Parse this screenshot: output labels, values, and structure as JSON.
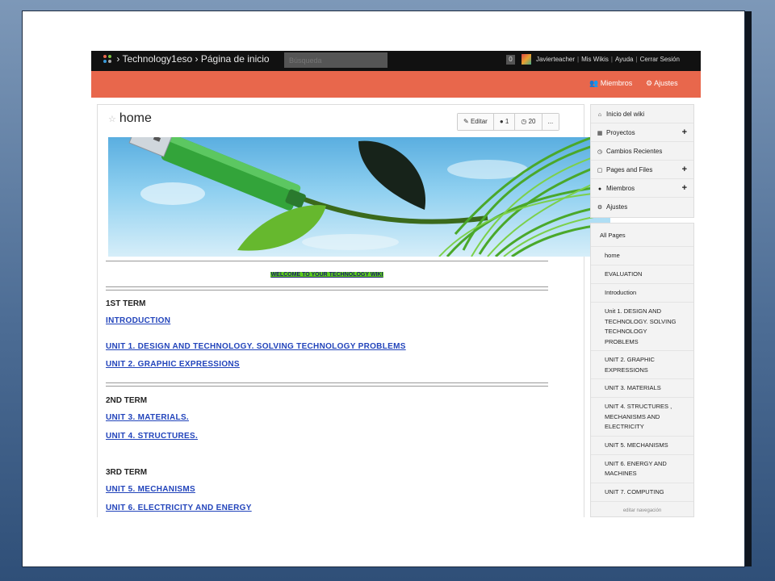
{
  "topbar": {
    "breadcrumb": "› Technology1eso › Página de inicio",
    "search_placeholder": "Búsqueda",
    "notification_count": "0",
    "user": "Javierteacher",
    "links": [
      "Mis Wikis",
      "Ayuda",
      "Cerrar Sesión"
    ]
  },
  "orangebar": {
    "members": "Miembros",
    "settings": "Ajustes"
  },
  "page": {
    "title": "home",
    "edit_label": "Editar",
    "comments_count": "1",
    "history_count": "20",
    "more_label": "..."
  },
  "content": {
    "welcome": "WELCOME TO YOUR TECHNOLOGY WIKI",
    "terms": [
      {
        "heading": "1ST TERM",
        "links": [
          "INTRODUCTION",
          "UNIT 1. DESIGN AND TECHNOLOGY. SOLVING TECHNOLOGY PROBLEMS",
          "UNIT 2. GRAPHIC EXPRESSIONS"
        ]
      },
      {
        "heading": "2ND TERM",
        "links": [
          "UNIT 3. MATERIALS.",
          "UNIT 4. STRUCTURES."
        ]
      },
      {
        "heading": "3RD TERM",
        "links": [
          "UNIT 5. MECHANISMS",
          "UNIT 6. ELECTRICITY AND ENERGY"
        ]
      }
    ]
  },
  "sidebar": {
    "nav": [
      {
        "icon": "home-icon",
        "label": "Inicio del wiki",
        "plus": ""
      },
      {
        "icon": "sitemap-icon",
        "label": "Proyectos",
        "plus": "+"
      },
      {
        "icon": "clock-icon",
        "label": "Cambios Recientes",
        "plus": ""
      },
      {
        "icon": "file-icon",
        "label": "Pages and Files",
        "plus": "+"
      },
      {
        "icon": "user-icon",
        "label": "Miembros",
        "plus": "+"
      },
      {
        "icon": "gear-icon",
        "label": "Ajustes",
        "plus": ""
      }
    ],
    "pages_header": "All Pages",
    "pages": [
      [
        "home"
      ],
      [
        "EVALUATION"
      ],
      [
        "Introduction"
      ],
      [
        "Unit 1. DESIGN AND",
        "TECHNOLOGY. SOLVING",
        "TECHNOLOGY",
        "PROBLEMS"
      ],
      [
        "UNIT 2. GRAPHIC",
        "EXPRESSIONS"
      ],
      [
        "UNIT 3. MATERIALS"
      ],
      [
        "UNIT 4. STRUCTURES ,",
        "MECHANISMS AND",
        "ELECTRICITY"
      ],
      [
        "UNIT 5. MECHANISMS"
      ],
      [
        "UNIT 6. ENERGY AND",
        "MACHINES"
      ],
      [
        "UNIT 7. COMPUTING"
      ]
    ],
    "edit_nav": "editar navegación"
  },
  "colors": {
    "accent": "#e8674c",
    "topbar": "#111111",
    "link": "#2244bb",
    "welcome_highlight": "#5dcc1d"
  }
}
